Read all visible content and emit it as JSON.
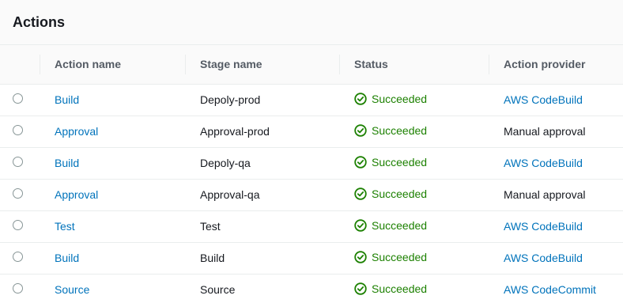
{
  "panel": {
    "title": "Actions"
  },
  "columns": [
    "",
    "Action name",
    "Stage name",
    "Status",
    "Action provider"
  ],
  "rows": [
    {
      "action_name": "Build",
      "stage_name": "Depoly-prod",
      "status": "Succeeded",
      "provider": "AWS CodeBuild",
      "provider_link": true
    },
    {
      "action_name": "Approval",
      "stage_name": "Approval-prod",
      "status": "Succeeded",
      "provider": "Manual approval",
      "provider_link": false
    },
    {
      "action_name": "Build",
      "stage_name": "Depoly-qa",
      "status": "Succeeded",
      "provider": "AWS CodeBuild",
      "provider_link": true
    },
    {
      "action_name": "Approval",
      "stage_name": "Approval-qa",
      "status": "Succeeded",
      "provider": "Manual approval",
      "provider_link": false
    },
    {
      "action_name": "Test",
      "stage_name": "Test",
      "status": "Succeeded",
      "provider": "AWS CodeBuild",
      "provider_link": true
    },
    {
      "action_name": "Build",
      "stage_name": "Build",
      "status": "Succeeded",
      "provider": "AWS CodeBuild",
      "provider_link": true
    },
    {
      "action_name": "Source",
      "stage_name": "Source",
      "status": "Succeeded",
      "provider": "AWS CodeCommit",
      "provider_link": true
    }
  ],
  "icons": {
    "status": "check-circle-icon"
  },
  "colors": {
    "link": "#0073bb",
    "success": "#1d8102",
    "header_bg": "#fafafa",
    "border": "#eaeded"
  }
}
